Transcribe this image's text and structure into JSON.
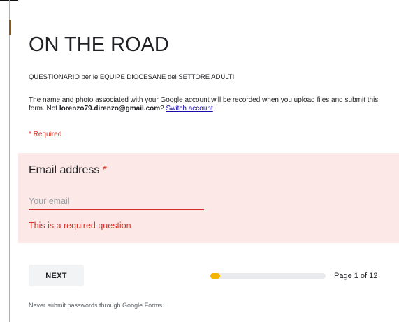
{
  "form": {
    "title": "ON THE ROAD",
    "subtitle": "QUESTIONARIO per le EQUIPE DIOCESANE del SETTORE ADULTI",
    "account_notice_text": "The name and photo associated with your Google account will be recorded when you upload files and submit this form. Not",
    "account_email": "lorenzo79.direnzo@gmail.com",
    "question_mark": "?",
    "switch_account_label": "Switch account",
    "required_note": "* Required"
  },
  "question": {
    "label": "Email address",
    "required_star": "*",
    "input_value": "",
    "input_placeholder": "Your email",
    "error_text": "This is a required question"
  },
  "navigation": {
    "next_label": "NEXT",
    "progress_fraction": 0.083,
    "page_indicator": "Page 1 of 12"
  },
  "footer": {
    "warning_text": "Never submit passwords through Google Forms."
  },
  "colors": {
    "error": "#d93025",
    "question_bg": "#fce8e6",
    "progress_fill": "#f4b400",
    "link": "#1a0dab"
  }
}
